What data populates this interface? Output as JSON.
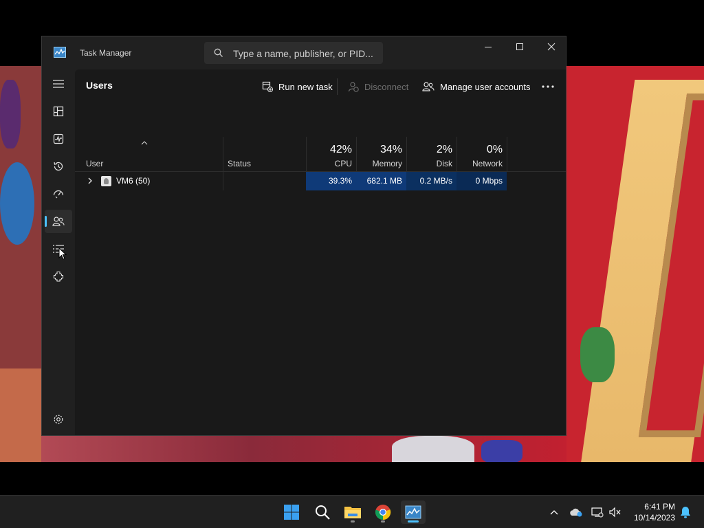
{
  "window": {
    "title": "Task Manager",
    "search_placeholder": "Type a name, publisher, or PID..."
  },
  "nav": [
    {
      "name": "hamburger-icon"
    },
    {
      "name": "processes-icon"
    },
    {
      "name": "performance-icon"
    },
    {
      "name": "app-history-icon"
    },
    {
      "name": "startup-apps-icon"
    },
    {
      "name": "users-icon",
      "active": true
    },
    {
      "name": "details-icon"
    },
    {
      "name": "services-icon"
    },
    {
      "name": "settings-icon"
    }
  ],
  "page": {
    "title": "Users",
    "commands": {
      "run_new_task": "Run new task",
      "disconnect": "Disconnect",
      "manage_accounts": "Manage user accounts"
    }
  },
  "table": {
    "columns": {
      "user": "User",
      "status": "Status",
      "cpu": {
        "pct": "42%",
        "label": "CPU"
      },
      "memory": {
        "pct": "34%",
        "label": "Memory"
      },
      "disk": {
        "pct": "2%",
        "label": "Disk"
      },
      "network": {
        "pct": "0%",
        "label": "Network"
      }
    },
    "rows": [
      {
        "user": "VM6 (50)",
        "status": "",
        "cpu": "39.3%",
        "memory": "682.1 MB",
        "disk": "0.2 MB/s",
        "network": "0 Mbps"
      }
    ]
  },
  "taskbar": {
    "apps": [
      "windows-start-icon",
      "search-icon",
      "file-explorer-icon",
      "chrome-icon",
      "task-manager-icon"
    ],
    "time": "6:41 PM",
    "date": "10/14/2023"
  },
  "colors": {
    "accent": "#4cc2ff",
    "heat_cell": "#0f3a78",
    "window_bg": "#202020",
    "content_bg": "#191919"
  }
}
